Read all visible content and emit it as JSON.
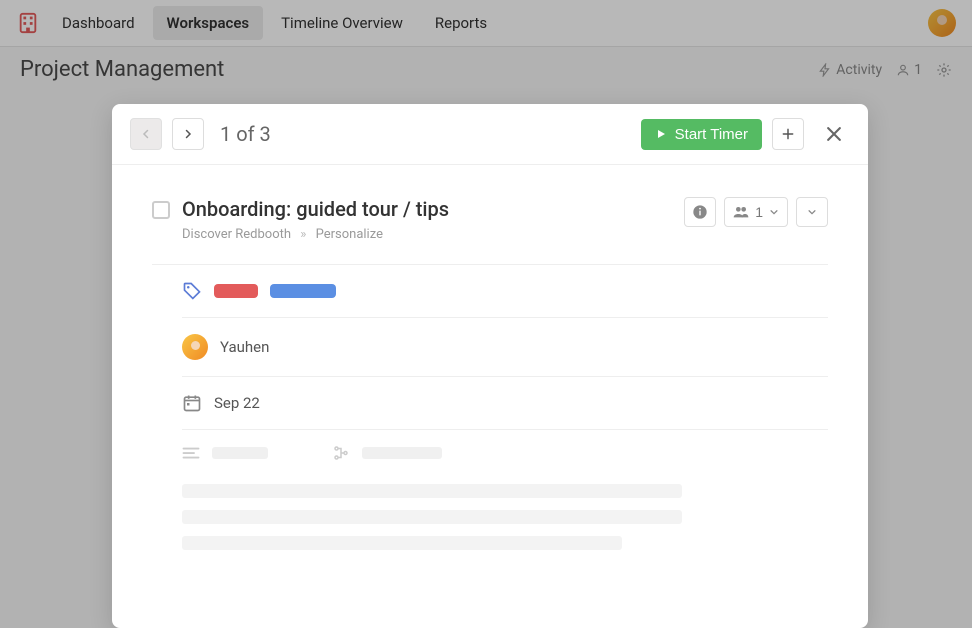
{
  "nav": {
    "items": [
      "Dashboard",
      "Workspaces",
      "Timeline Overview",
      "Reports"
    ],
    "active_index": 1
  },
  "subheader": {
    "title": "Project Management",
    "activity_label": "Activity",
    "members_count": "1"
  },
  "modal": {
    "counter": "1 of 3",
    "start_timer_label": "Start Timer",
    "task_title": "Onboarding: guided tour / tips",
    "breadcrumb": {
      "workspace": "Discover Redbooth",
      "list": "Personalize"
    },
    "followers_count": "1",
    "tags": [
      {
        "color": "#e35b5b"
      },
      {
        "color": "#5b8fe3"
      }
    ],
    "assignee": "Yauhen",
    "due_date": "Sep 22"
  }
}
